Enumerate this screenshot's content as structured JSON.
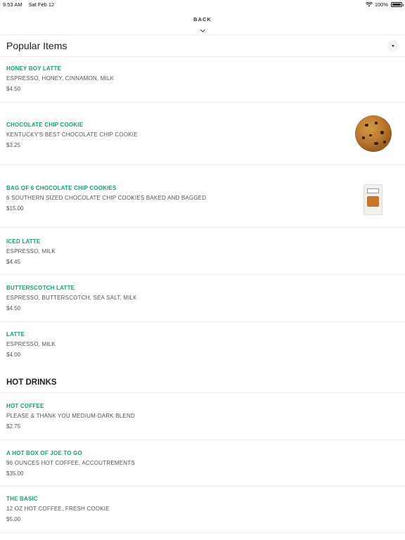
{
  "status_bar": {
    "time": "9:53 AM",
    "date": "Sat Feb 12",
    "battery": "100%"
  },
  "nav": {
    "back_label": "BACK"
  },
  "popular": {
    "title": "Popular Items",
    "items": [
      {
        "name": "HONEY BOY LATTE",
        "desc": "ESPRESSO, HONEY, CINNAMON, MILK",
        "price": "$4.50"
      },
      {
        "name": "CHOCOLATE CHIP COOKIE",
        "desc": "KENTUCKY'S BEST CHOCOLATE CHIP COOKIE",
        "price": "$3.25",
        "image": "chocolate-chip-cookie"
      },
      {
        "name": "BAG OF 6 CHOCOLATE CHIP COOKIES",
        "desc": "6 SOUTHERN SIZED CHOCOLATE CHIP COOKIES BAKED AND BAGGED",
        "price": "$15.00",
        "image": "cookie-bag"
      },
      {
        "name": "ICED LATTE",
        "desc": "ESPRESSO, MILK",
        "price": "$4.45"
      },
      {
        "name": "BUTTERSCOTCH LATTE",
        "desc": "ESPRESSO, BUTTERSCOTCH, SEA SALT, MILK",
        "price": "$4.50"
      },
      {
        "name": "LATTE",
        "desc": "ESPRESSO, MILK",
        "price": "$4.00"
      }
    ]
  },
  "hot_drinks": {
    "title": "HOT DRINKS",
    "items": [
      {
        "name": "HOT COFFEE",
        "desc": "PLEASE & THANK YOU MEDIUM-DARK BLEND",
        "price": "$2.75"
      },
      {
        "name": "A HOT BOX OF JOE TO GO",
        "desc": "96 OUNCES HOT COFFEE, ACCOUTREMENTS",
        "price": "$35.00"
      },
      {
        "name": "THE BASIC",
        "desc": "12 OZ HOT COFFEE, FRESH COOKIE",
        "price": "$5.00"
      }
    ]
  },
  "colors": {
    "item_name": "#1a9e6e",
    "text": "#555555",
    "divider": "#ececec"
  }
}
